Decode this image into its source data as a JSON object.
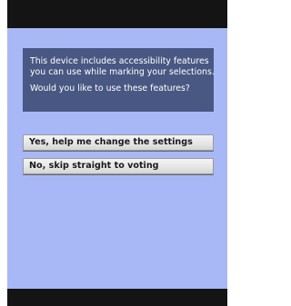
{
  "accessibility_prompt": {
    "line1": "This device includes accessibility features",
    "line2": "you can use while marking your selections.",
    "question": "Would you like to use these features?"
  },
  "options": {
    "yes_label": "Yes, help me change the settings",
    "no_label": "No, skip straight to voting"
  },
  "colors": {
    "background": "#a8b8f6",
    "info_box": "#485882",
    "bars": "#141414",
    "button": "#e6e6e6"
  }
}
